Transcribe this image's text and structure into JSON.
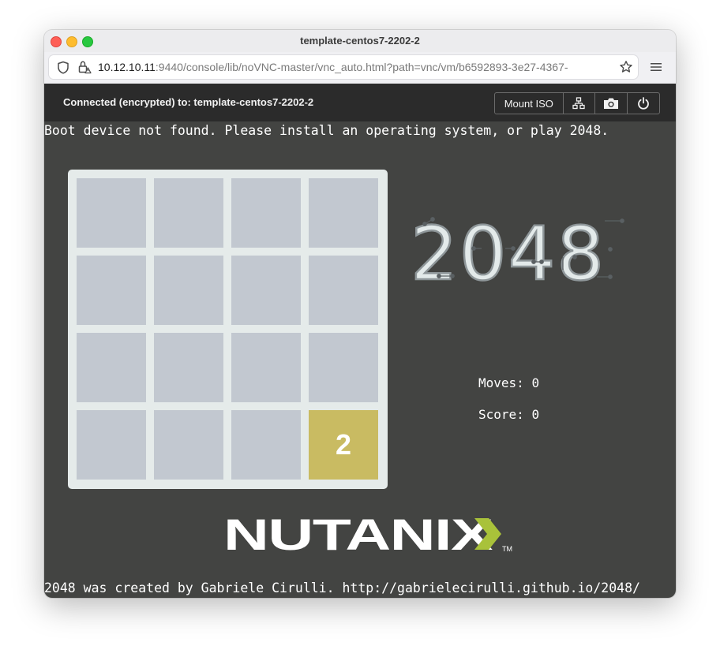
{
  "window": {
    "title": "template-centos7-2202-2"
  },
  "browser": {
    "url_host": "10.12.10.11",
    "url_rest": ":9440/console/lib/noVNC-master/vnc_auto.html?path=vnc/vm/b6592893-3e27-4367-"
  },
  "vnc": {
    "status": "Connected (encrypted) to: template-centos7-2202-2",
    "mount_iso_label": "Mount ISO",
    "toolbar_icons": [
      "network-icon",
      "camera-icon",
      "power-icon"
    ]
  },
  "console": {
    "boot_message": "Boot device not found. Please install an operating system, or play 2048.",
    "credit": "2048 was created by Gabriele Cirulli. http://gabrielecirulli.github.io/2048/"
  },
  "game": {
    "title": "2048",
    "moves_label": "Moves:",
    "moves": "0",
    "score_label": "Score:",
    "score": "0",
    "grid": [
      [
        "",
        "",
        "",
        ""
      ],
      [
        "",
        "",
        "",
        ""
      ],
      [
        "",
        "",
        "",
        ""
      ],
      [
        "",
        "",
        "",
        "2"
      ]
    ]
  },
  "brand": {
    "name": "NUTANIX",
    "tm": "TM"
  },
  "colors": {
    "console_bg": "#434442",
    "board_bg": "#e5ebea",
    "empty_cell": "#c2c8d0",
    "tile_2": "#c9bb62",
    "nutanix_accent": "#a9c23a"
  }
}
